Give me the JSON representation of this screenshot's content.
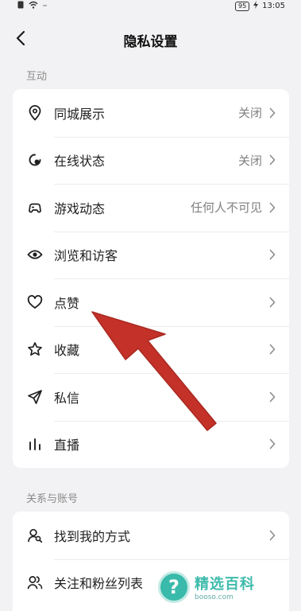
{
  "status_bar": {
    "battery": "95",
    "time": "13:05"
  },
  "header": {
    "title": "隐私设置"
  },
  "sections": [
    {
      "label": "互动",
      "items": [
        {
          "label": "同城展示",
          "value": "关闭",
          "icon": "location-pin-icon"
        },
        {
          "label": "在线状态",
          "value": "关闭",
          "icon": "online-status-icon"
        },
        {
          "label": "游戏动态",
          "value": "任何人不可见",
          "icon": "game-controller-icon"
        },
        {
          "label": "浏览和访客",
          "value": "",
          "icon": "eye-icon"
        },
        {
          "label": "点赞",
          "value": "",
          "icon": "heart-icon"
        },
        {
          "label": "收藏",
          "value": "",
          "icon": "star-icon"
        },
        {
          "label": "私信",
          "value": "",
          "icon": "paper-plane-icon"
        },
        {
          "label": "直播",
          "value": "",
          "icon": "live-bars-icon"
        }
      ]
    },
    {
      "label": "关系与账号",
      "items": [
        {
          "label": "找到我的方式",
          "value": "",
          "icon": "find-user-icon"
        },
        {
          "label": "关注和粉丝列表",
          "value": "",
          "icon": "followers-icon"
        }
      ]
    }
  ],
  "annotation": {
    "arrow_color": "#c0261d"
  },
  "watermark": {
    "main": "精选百科",
    "sub": "booso.com",
    "glyph": "?"
  }
}
